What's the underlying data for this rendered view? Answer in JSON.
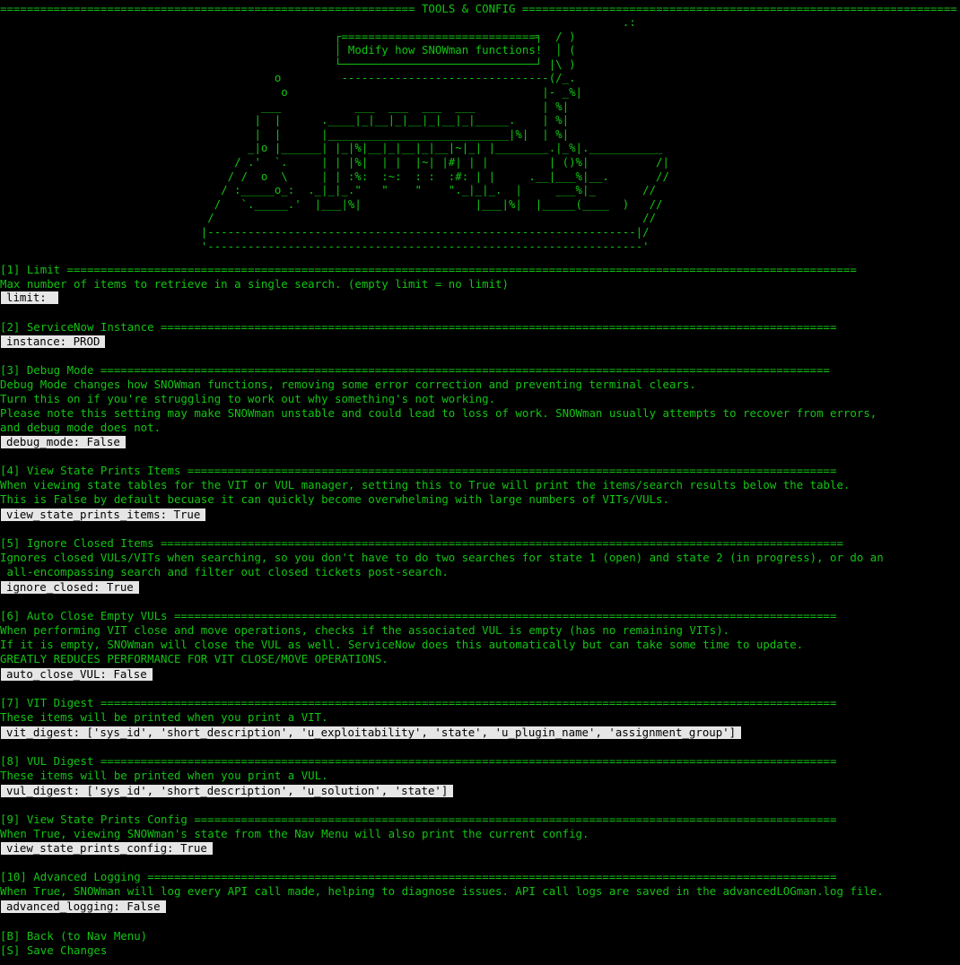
{
  "header": {
    "title": " TOOLS & CONFIG "
  },
  "art": {
    "banner_text": "Modify how SNOWman functions!"
  },
  "sections": [
    {
      "title": "[1] Limit",
      "desc": [
        "Max number of items to retrieve in a single search. (empty limit = no limit)"
      ],
      "value": "limit: "
    },
    {
      "title": "[2] ServiceNow Instance",
      "desc": [],
      "value": "instance: PROD"
    },
    {
      "title": "[3] Debug Mode",
      "desc": [
        "Debug Mode changes how SNOWman functions, removing some error correction and preventing terminal clears.",
        "Turn this on if you're struggling to work out why something's not working.",
        "Please note this setting may make SNOWman unstable and could lead to loss of work. SNOWman usually attempts to recover from errors,",
        "and debug mode does not."
      ],
      "value": "debug_mode: False"
    },
    {
      "title": "[4] View State Prints Items",
      "desc": [
        "When viewing state tables for the VIT or VUL manager, setting this to True will print the items/search results below the table.",
        "This is False by default becuase it can quickly become overwhelming with large numbers of VITs/VULs."
      ],
      "value": "view_state_prints_items: True"
    },
    {
      "title": "[5] Ignore Closed Items",
      "desc": [
        "Ignores closed VULs/VITs when searching, so you don't have to do two searches for state 1 (open) and state 2 (in progress), or do an",
        " all-encompassing search and filter out closed tickets post-search."
      ],
      "value": "ignore_closed: True"
    },
    {
      "title": "[6] Auto Close Empty VULs",
      "desc": [
        "When performing VIT close and move operations, checks if the associated VUL is empty (has no remaining VITs).",
        "If it is empty, SNOWman will close the VUL as well. ServiceNow does this automatically but can take some time to update.",
        "GREATLY REDUCES PERFORMANCE FOR VIT CLOSE/MOVE OPERATIONS."
      ],
      "value": "auto_close_VUL: False"
    },
    {
      "title": "[7] VIT Digest",
      "desc": [
        "These items will be printed when you print a VIT."
      ],
      "value": "vit_digest: ['sys_id', 'short_description', 'u_exploitability', 'state', 'u_plugin_name', 'assignment_group']"
    },
    {
      "title": "[8] VUL Digest",
      "desc": [
        "These items will be printed when you print a VUL."
      ],
      "value": "vul_digest: ['sys_id', 'short_description', 'u_solution', 'state']"
    },
    {
      "title": "[9] View State Prints Config",
      "desc": [
        "When True, viewing SNOWman's state from the Nav Menu will also print the current config."
      ],
      "value": "view_state_prints_config: True"
    },
    {
      "title": "[10] Advanced Logging",
      "desc": [
        "When True, SNOWman will log every API call made, helping to diagnose issues. API call logs are saved in the advancedLOGman.log file."
      ],
      "value": "advanced_logging: False"
    }
  ],
  "menu": {
    "back": "[B] Back (to Nav Menu)",
    "save": "[S] Save Changes"
  },
  "colors": {
    "background": "#000000",
    "text": "#13c413",
    "value_box_bg": "#e6e6e6",
    "value_box_text": "#000000"
  }
}
